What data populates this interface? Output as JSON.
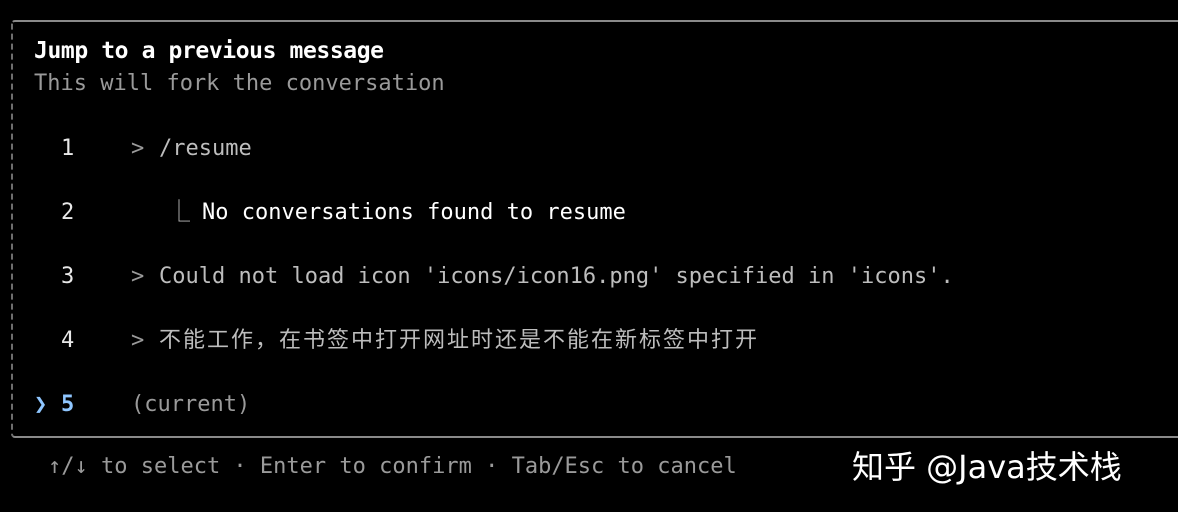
{
  "dialog": {
    "title": "Jump to a previous message",
    "subtitle": "This will fork the conversation"
  },
  "messages": [
    {
      "number": "1",
      "caret": ">",
      "text": "/resume"
    },
    {
      "number": "2",
      "reply_mark": "⎿",
      "text": "No conversations found to resume"
    },
    {
      "number": "3",
      "caret": ">",
      "text": "Could not load icon 'icons/icon16.png' specified in 'icons'."
    },
    {
      "number": "4",
      "caret": ">",
      "text": "不能工作，在书签中打开网址时还是不能在新标签中打开"
    },
    {
      "number": "5",
      "pointer": "❯",
      "text": "(current)"
    }
  ],
  "footer": {
    "hint": "↑/↓ to select · Enter to confirm · Tab/Esc to cancel"
  },
  "watermark": "知乎 @Java技术栈",
  "colors": {
    "background": "#000000",
    "selection_accent": "#8fc6ff",
    "muted_text": "#9a9a9a",
    "border": "#8a8a8a"
  }
}
